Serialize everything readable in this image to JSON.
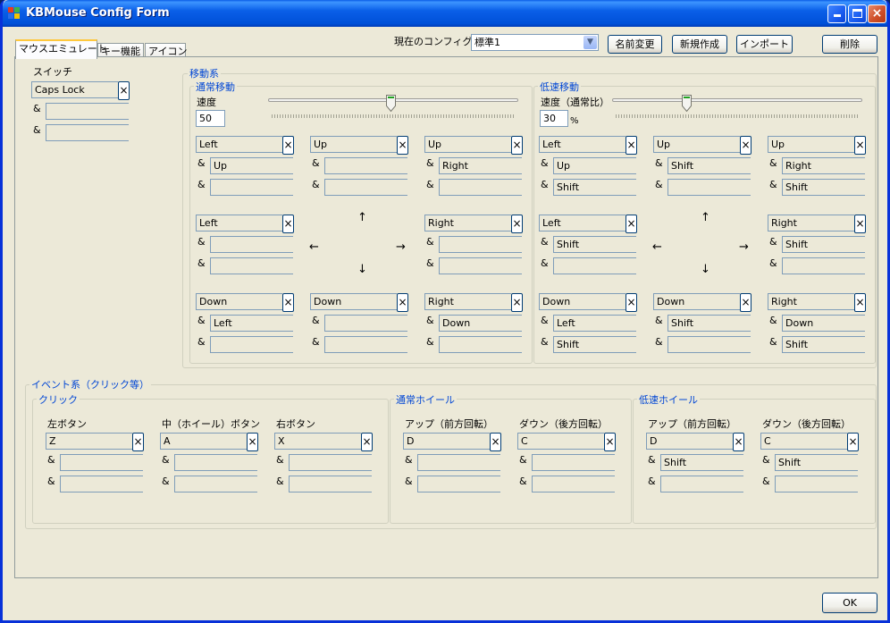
{
  "window": {
    "title": "KBMouse Config Form"
  },
  "tabs": [
    "マウスエミュレート",
    "キー機能",
    "アイコン"
  ],
  "toolbar": {
    "config_label": "現在のコンフィグ",
    "config_value": "標準1",
    "rename": "名前変更",
    "new": "新規作成",
    "import": "インポート",
    "delete": "削除"
  },
  "switch": {
    "title": "スイッチ",
    "key1": "Caps Lock",
    "key2": "",
    "key3": ""
  },
  "movement": {
    "title": "移動系",
    "normal": {
      "title": "通常移動",
      "speed_label": "速度",
      "speed": "50",
      "slider_fraction": 0.49,
      "cells": [
        [
          "Left",
          "Up",
          ""
        ],
        [
          "Up",
          "",
          ""
        ],
        [
          "Up",
          "Right",
          ""
        ],
        [
          "Left",
          "",
          ""
        ],
        null,
        [
          "Right",
          "",
          ""
        ],
        [
          "Down",
          "Left",
          ""
        ],
        [
          "Down",
          "",
          ""
        ],
        [
          "Right",
          "Down",
          ""
        ]
      ]
    },
    "slow": {
      "title": "低速移動",
      "speed_label": "速度（通常比）",
      "speed": "30",
      "speed_unit": "%",
      "slider_fraction": 0.29,
      "cells": [
        [
          "Left",
          "Up",
          "Shift"
        ],
        [
          "Up",
          "Shift",
          ""
        ],
        [
          "Up",
          "Right",
          "Shift"
        ],
        [
          "Left",
          "Shift",
          ""
        ],
        null,
        [
          "Right",
          "Shift",
          ""
        ],
        [
          "Down",
          "Left",
          "Shift"
        ],
        [
          "Down",
          "Shift",
          ""
        ],
        [
          "Right",
          "Down",
          "Shift"
        ]
      ]
    },
    "arrows": {
      "up": "↑",
      "down": "↓",
      "left": "←",
      "right": "→"
    }
  },
  "events": {
    "title": "イベント系（クリック等）",
    "click": {
      "title": "クリック",
      "cols": [
        {
          "label": "左ボタン",
          "keys": [
            "Z",
            "",
            ""
          ]
        },
        {
          "label": "中（ホイール）ボタン",
          "keys": [
            "A",
            "",
            ""
          ]
        },
        {
          "label": "右ボタン",
          "keys": [
            "X",
            "",
            ""
          ]
        }
      ]
    },
    "wheel": {
      "title": "通常ホイール",
      "cols": [
        {
          "label": "アップ（前方回転）",
          "keys": [
            "D",
            "",
            ""
          ]
        },
        {
          "label": "ダウン（後方回転）",
          "keys": [
            "C",
            "",
            ""
          ]
        }
      ]
    },
    "slow_wheel": {
      "title": "低速ホイール",
      "cols": [
        {
          "label": "アップ（前方回転）",
          "keys": [
            "D",
            "Shift",
            ""
          ]
        },
        {
          "label": "ダウン（後方回転）",
          "keys": [
            "C",
            "Shift",
            ""
          ]
        }
      ]
    }
  },
  "amp": "&",
  "clear_glyph": "×",
  "ok": "OK",
  "colors": {
    "title_bar": "#0a5fe8",
    "group_title": "#0046d5",
    "close_button": "#d0502a"
  }
}
